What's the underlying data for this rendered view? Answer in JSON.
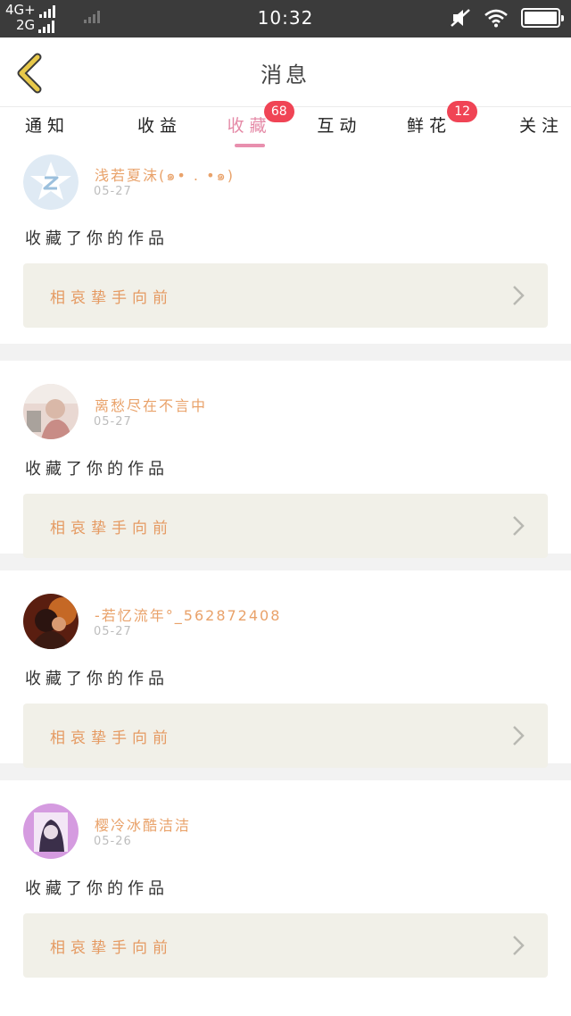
{
  "status_bar": {
    "net_top": "4G+",
    "net_bottom": "2G",
    "time": "10:32",
    "battery_level": 1.0
  },
  "header": {
    "title": "消息",
    "back_icon": "chevron-left-icon",
    "accent": "#e8c94a"
  },
  "tabs": [
    {
      "label": "通知"
    },
    {
      "label": "收益"
    },
    {
      "label": "收藏",
      "badge": "68",
      "active": true
    },
    {
      "label": "互动"
    },
    {
      "label": "鲜花",
      "badge": "12"
    },
    {
      "label": "关注"
    }
  ],
  "feed": [
    {
      "username": "浅若夏沫(๑•  .  •๑)",
      "date": "05-27",
      "action": "收藏了你的作品",
      "work_title": "相哀挚手向前",
      "avatar": "qzone-star-icon"
    },
    {
      "username": "离愁尽在不言中",
      "date": "05-27",
      "action": "收藏了你的作品",
      "work_title": "相哀挚手向前",
      "avatar": "user-photo"
    },
    {
      "username": "-若忆流年°_562872408",
      "date": "05-27",
      "action": "收藏了你的作品",
      "work_title": "相哀挚手向前",
      "avatar": "user-photo"
    },
    {
      "username": "樱冷冰酷洁洁",
      "date": "05-26",
      "action": "收藏了你的作品",
      "work_title": "相哀挚手向前",
      "avatar": "user-photo"
    }
  ],
  "colors": {
    "badge": "#f04455",
    "active_tab": "#e58aa7",
    "username": "#e9a26a",
    "work_title": "#e59a62",
    "work_box": "#f1f0e8"
  }
}
